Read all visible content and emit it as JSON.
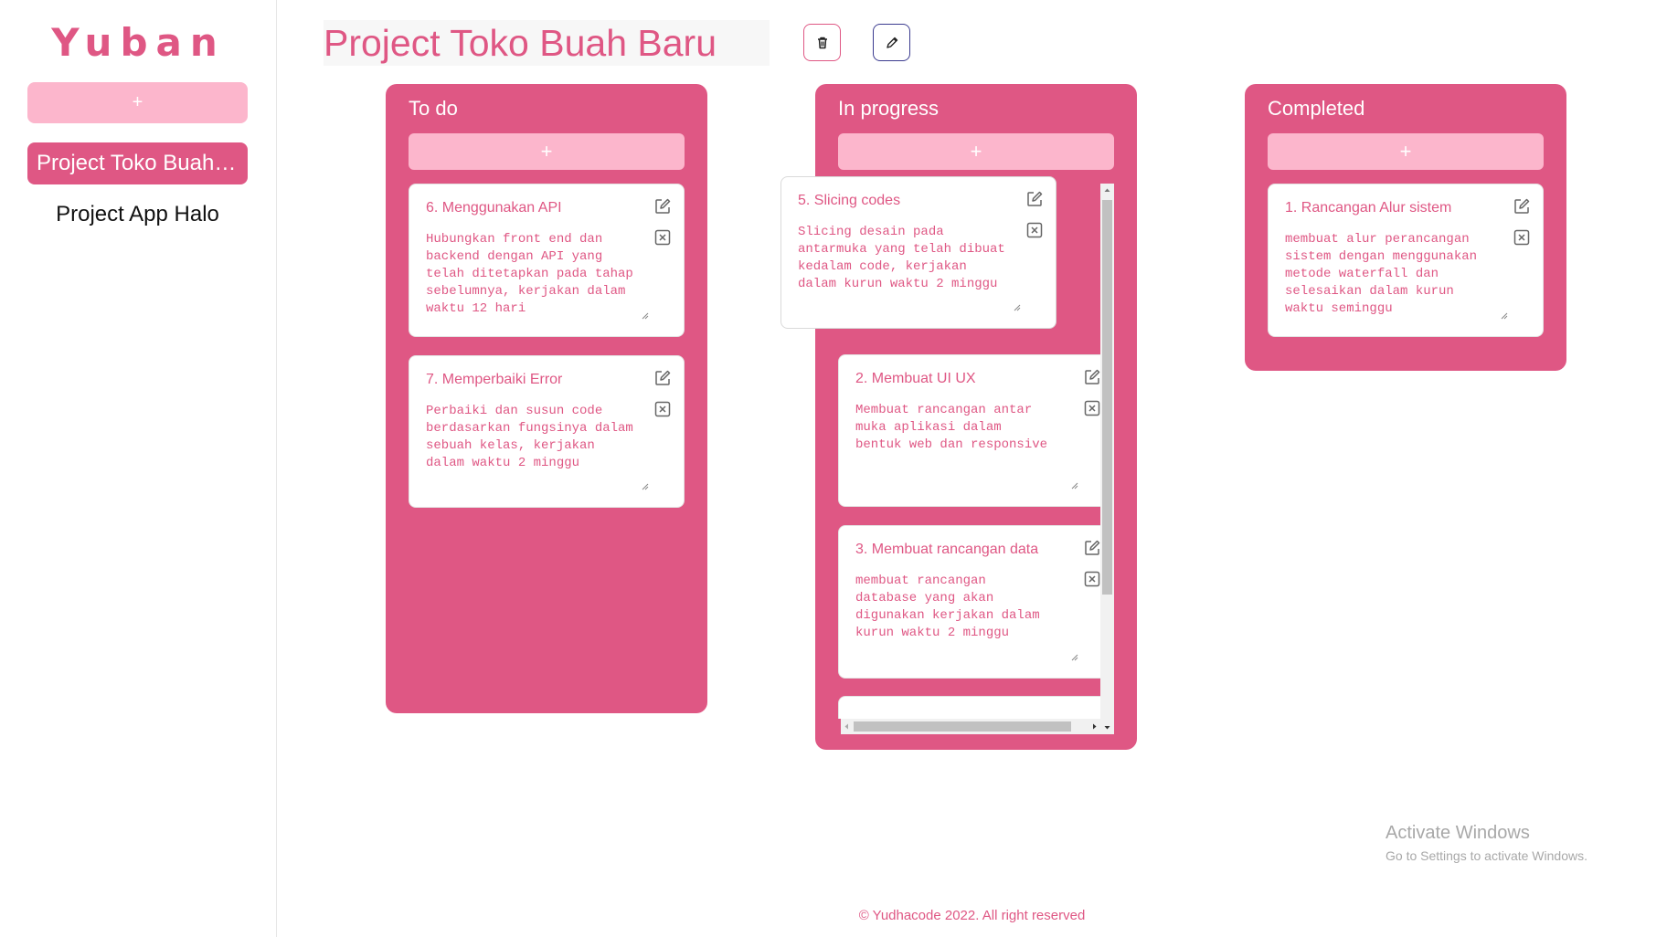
{
  "sidebar": {
    "brand": "Yuban",
    "add_label": "+",
    "projects": [
      {
        "label": "Project Toko Buah Baru",
        "active": true
      },
      {
        "label": "Project App Halo",
        "active": false
      }
    ]
  },
  "header": {
    "title": "Project Toko Buah Baru",
    "delete_icon": "trash-icon",
    "edit_icon": "pencil-icon"
  },
  "columns": [
    {
      "title": "To do",
      "add_label": "+",
      "cards": [
        {
          "title": "6. Menggunakan API",
          "desc": "Hubungkan front end dan\nbackend dengan API yang\ntelah ditetapkan pada tahap\nsebelumnya, kerjakan dalam\nwaktu 12 hari"
        },
        {
          "title": "7. Memperbaiki Error",
          "desc": "Perbaiki dan susun code\nberdasarkan fungsinya dalam\nsebuah kelas, kerjakan\ndalam waktu 2 minggu"
        }
      ]
    },
    {
      "title": "In progress",
      "add_label": "+",
      "cards": [
        {
          "title": "5. Slicing codes",
          "desc": "Slicing desain pada\nantarmuka yang telah dibuat\nkedalam code, kerjakan\ndalam kurun waktu 2 minggu"
        },
        {
          "title": "2. Membuat UI UX",
          "desc": "Membuat rancangan antar\nmuka aplikasi dalam\nbentuk web dan responsive"
        },
        {
          "title": "3. Membuat rancangan data",
          "desc": "membuat rancangan\ndatabase yang akan\ndigunakan kerjakan dalam\nkurun waktu 2 minggu"
        }
      ]
    },
    {
      "title": "Completed",
      "add_label": "+",
      "cards": [
        {
          "title": "1. Rancangan Alur sistem",
          "desc": "membuat alur perancangan\nsistem dengan menggunakan\nmetode waterfall dan\nselesaikan dalam kurun\nwaktu seminggu"
        }
      ]
    }
  ],
  "windows_notice": {
    "line1": "Activate Windows",
    "line2": "Go to Settings to activate Windows."
  },
  "footer": "© Yudhacode 2022. All right reserved",
  "colors": {
    "accent": "#df5784",
    "accent_light": "#fcb6cc",
    "white": "#ffffff"
  }
}
